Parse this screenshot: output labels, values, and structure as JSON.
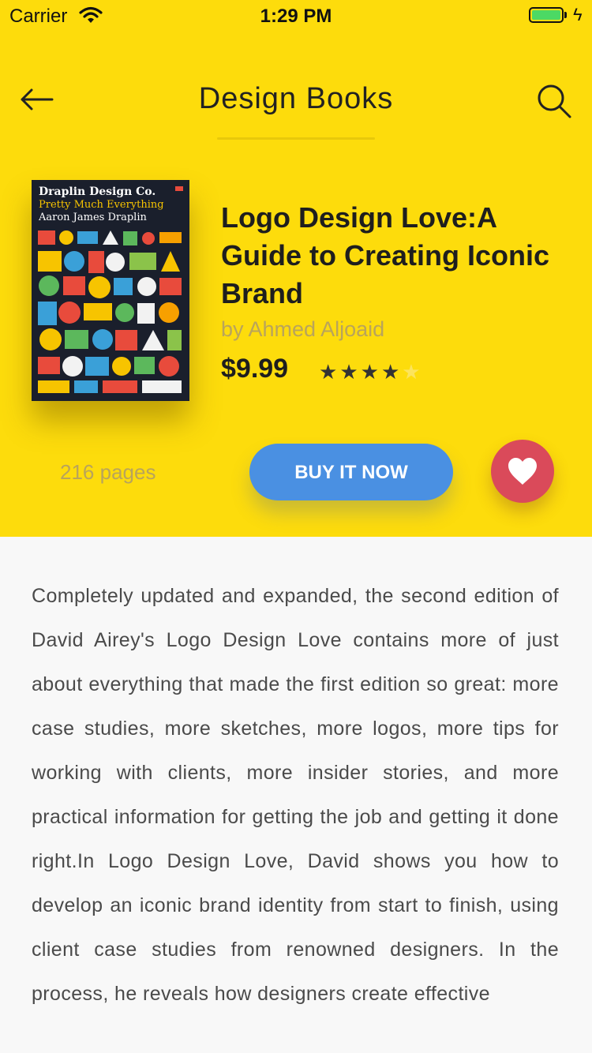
{
  "status_bar": {
    "carrier": "Carrier",
    "time": "1:29 PM"
  },
  "header": {
    "title": "Design Books",
    "back_icon": "arrow-left-icon",
    "search_icon": "search-icon"
  },
  "book": {
    "cover": {
      "line1": "Draplin Design Co.",
      "line2": "Pretty Much Everything",
      "line3": "Aaron James Draplin"
    },
    "title": "Logo Design Love:A Guide to Creating Iconic Brand",
    "author": "by Ahmed Aljoaid",
    "price": "$9.99",
    "rating": 4,
    "rating_max": 5,
    "pages": "216 pages"
  },
  "actions": {
    "buy_label": "BUY IT NOW",
    "favorite_icon": "heart-icon"
  },
  "description": "Completely updated and expanded, the second edition of David Airey's Logo Design Love contains more of just about everything that made the first edition so great: more case studies, more sketches, more logos, more tips for working with clients, more insider stories, and more practical information for getting the job and getting it done right.In Logo Design Love, David shows you how to develop an iconic brand identity from start to finish, using client case studies from renowned designers. In the process, he reveals how designers create effective",
  "colors": {
    "header_bg": "#FDDC0C",
    "buy_button": "#4A90E2",
    "favorite_button": "#DA4A5A",
    "muted_text": "#B9A45B"
  }
}
